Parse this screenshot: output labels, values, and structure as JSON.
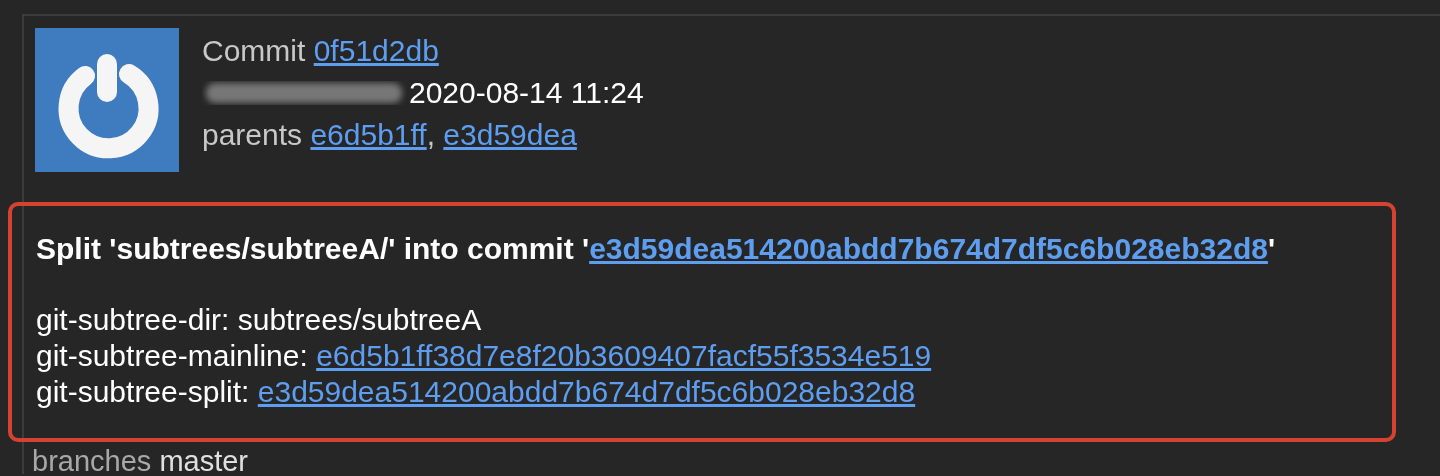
{
  "commit": {
    "label": "Commit",
    "hash": "0f51d2db",
    "date": "2020-08-14 11:24",
    "parents_label": "parents",
    "parents_separator": ",",
    "parents": [
      "e6d5b1ff",
      "e3d59dea"
    ]
  },
  "message": {
    "title_prefix": "Split 'subtrees/subtreeA/' into commit '",
    "title_hash": "e3d59dea514200abdd7b674d7df5c6b028eb32d8",
    "title_suffix": "'",
    "lines": [
      {
        "kind": "text",
        "label": "git-subtree-dir:",
        "value": "subtrees/subtreeA"
      },
      {
        "kind": "link",
        "label": "git-subtree-mainline:",
        "value": "e6d5b1ff38d7e8f20b3609407facf55f3534e519"
      },
      {
        "kind": "link",
        "label": "git-subtree-split:",
        "value": "e3d59dea514200abdd7b674d7df5c6b028eb32d8"
      }
    ]
  },
  "branches": {
    "label": "branches",
    "value": "master"
  }
}
